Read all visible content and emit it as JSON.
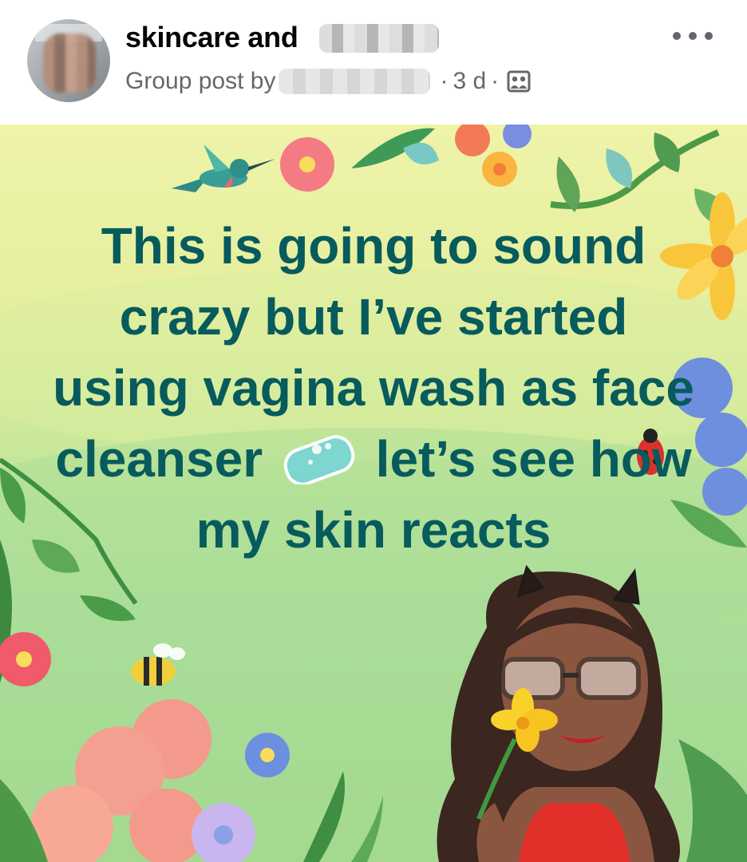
{
  "header": {
    "group_name": "skincare and",
    "meta_prefix": "Group post by",
    "meta_time": "3 d",
    "meta_separator": "·"
  },
  "post": {
    "text_before_emoji": "This is going to sound crazy but I’ve started using vagina wash as face cleanser",
    "text_after_emoji": "let’s see how my skin reacts",
    "emoji": "soap-icon"
  },
  "colors": {
    "text": "#075b5d",
    "name": "#050505",
    "meta": "#65676b"
  }
}
